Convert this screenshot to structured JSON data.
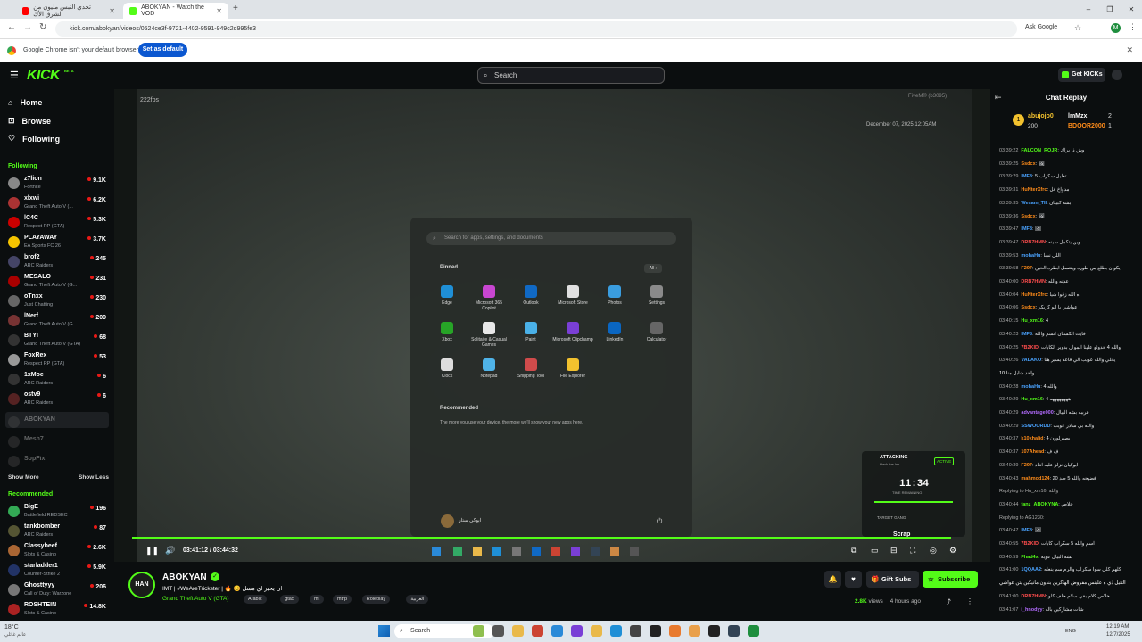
{
  "browser": {
    "tabs": [
      {
        "label": "تحدي النبس مليون من الشرق الأك",
        "favicon_color": "#ff0000"
      },
      {
        "label": "ABOKYAN - Watch the VOD",
        "favicon_color": "#53fc18"
      }
    ],
    "new_tab": "+",
    "window": {
      "minimize": "–",
      "restore": "❐",
      "close": "✕"
    },
    "url": "kick.com/abokyan/videos/0524ce3f-9721-4402-9591-949c2d995fe3",
    "ask_google": "Ask Google",
    "profile": "M",
    "infobar_message": "Google Chrome isn't your default browser",
    "infobar_button": "Set as default",
    "infobar_close": "✕"
  },
  "kick": {
    "logo": "KICK",
    "logo_badge": "BETA",
    "search_placeholder": "Search",
    "get_kicks": "Get KICKs",
    "accent": "#53fc18"
  },
  "sidebar": {
    "nav": [
      {
        "label": "Home",
        "icon": "home-icon"
      },
      {
        "label": "Browse",
        "icon": "browse-icon"
      },
      {
        "label": "Following",
        "icon": "heart-icon"
      }
    ],
    "following_header": "Following",
    "following": [
      {
        "name": "z7lion",
        "sub": "Fortnite",
        "count": "9.1K",
        "color": "#888"
      },
      {
        "name": "xlxwi",
        "sub": "Grand Theft Auto V (...",
        "count": "6.2K",
        "color": "#a33"
      },
      {
        "name": "lC4C",
        "sub": "Respect RP (GTA)",
        "count": "5.3K",
        "color": "#c00"
      },
      {
        "name": "PLAYAWAY",
        "sub": "EA Sports FC 26",
        "count": "3.7K",
        "color": "#f5c400"
      },
      {
        "name": "brof2",
        "sub": "ARC Raiders",
        "count": "245",
        "color": "#446"
      },
      {
        "name": "MESALO",
        "sub": "Grand Theft Auto V (G...",
        "count": "231",
        "color": "#a00"
      },
      {
        "name": "oTnxx",
        "sub": "Just Chatting",
        "count": "230",
        "color": "#666"
      },
      {
        "name": "lNerf",
        "sub": "Grand Theft Auto V (G...",
        "count": "209",
        "color": "#733"
      },
      {
        "name": "BTYI",
        "sub": "Grand Theft Auto V (GTA)",
        "count": "68",
        "color": "#333"
      },
      {
        "name": "FoxRex",
        "sub": "Respect RP (GTA)",
        "count": "53",
        "color": "#999"
      },
      {
        "name": "1xMoe",
        "sub": "ARC Raiders",
        "count": "6",
        "color": "#333"
      },
      {
        "name": "ostv9",
        "sub": "ARC Raiders",
        "count": "6",
        "color": "#522"
      }
    ],
    "offline": [
      {
        "name": "ABOKYAN"
      },
      {
        "name": "Mesh7"
      },
      {
        "name": "SopFix"
      }
    ],
    "show_more": "Show More",
    "show_less": "Show Less",
    "recommended_header": "Recommended",
    "recommended": [
      {
        "name": "BigE",
        "sub": "Battlefield REDSEC",
        "count": "196",
        "color": "#3a5"
      },
      {
        "name": "tankbomber",
        "sub": "ARC Raiders",
        "count": "87",
        "color": "#553"
      },
      {
        "name": "Classybeef",
        "sub": "Slots & Casino",
        "count": "2.6K",
        "color": "#a63"
      },
      {
        "name": "starladder1",
        "sub": "Counter-Strike 2",
        "count": "5.9K",
        "color": "#236"
      },
      {
        "name": "Ghosttyyy",
        "sub": "Call of Duty: Warzone",
        "count": "206",
        "color": "#777"
      },
      {
        "name": "ROSHTEIN",
        "sub": "Slots & Casino",
        "count": "14.8K",
        "color": "#a22"
      }
    ]
  },
  "video": {
    "fps": "222fps",
    "watermark": "FiveM® (b3095)",
    "date_overlay": "December 07, 2025 12:05AM",
    "start_search": "Search for apps, settings, and documents",
    "pinned": "Pinned",
    "all": "All",
    "apps": [
      "Edge",
      "Microsoft 365 Copilot",
      "Outlook",
      "Microsoft Store",
      "Photos",
      "Settings",
      "Xbox",
      "Solitaire & Casual Games",
      "Paint",
      "Microsoft Clipchamp",
      "LinkedIn",
      "Calculator",
      "Clock",
      "Notepad",
      "Snipping Tool",
      "File Explorer"
    ],
    "app_colors": [
      "#1f8fd6",
      "#c846d1",
      "#1069c4",
      "#e0e0e0",
      "#3a9ddf",
      "#8a8a8a",
      "#27a427",
      "#e8e8e8",
      "#4ab1e8",
      "#7a3fd6",
      "#0a66c2",
      "#666",
      "#ddd",
      "#4fb3e8",
      "#d04b4b",
      "#f2c12e"
    ],
    "recommended": "Recommended",
    "recommended_text": "The more you use your device, the more we'll show your new apps here.",
    "user_name": "ابوكي ستار",
    "power": "⏻",
    "hud": {
      "title": "ATTACKING",
      "sub": "Hack the lab",
      "status": "ACTIVE",
      "timer": "11:34",
      "timer_label": "TIME REMAINING",
      "target": "TARGET GANG",
      "target_name": "Scrap"
    },
    "time": "03:41:12 / 03:44:32",
    "progress": 0.985
  },
  "channel": {
    "name": "ABOKYAN",
    "avatar_text": "HAN",
    "title": "IMT | #WeAreTrickster | 🔥 😊 ان يحير اي مسل",
    "category": "Grand Theft Auto V (GTA)",
    "tags": [
      "Arabic",
      "gta5",
      "mt",
      "mtrp",
      "Roleplay",
      "العربية"
    ],
    "gift": "Gift Subs",
    "subscribe": "Subscribe",
    "views": "2.8K",
    "views_label": "views",
    "ago": "4 hours ago",
    "share": "⤴",
    "more": "⋮"
  },
  "chat": {
    "title": "Chat Replay",
    "leader": {
      "name": "abujojo0",
      "amount": "200",
      "second": "lmMzx",
      "second_n": "2",
      "third": "BDOOR2000",
      "third_n": "1"
    },
    "messages": [
      {
        "t": "03:39:22",
        "u": "FALCON_ROJR",
        "c": "#53fc18",
        "m": "وش ذا براك"
      },
      {
        "t": "03:39:25",
        "u": "Ssdcx",
        "c": "#ff8c1a",
        "m": "🖼"
      },
      {
        "t": "03:39:29",
        "u": "IMF8",
        "c": "#4aa3ff",
        "m": "5 تعليل سكراب"
      },
      {
        "t": "03:39:31",
        "u": "HuNterXfrc",
        "c": "#ff8c1a",
        "m": "مدواخ فل"
      },
      {
        "t": "03:39:35",
        "u": "Wesam_TII",
        "c": "#4aa3ff",
        "m": "بشه كبيبان"
      },
      {
        "t": "03:39:36",
        "u": "Ssdcx",
        "c": "#ff8c1a",
        "m": "🖼"
      },
      {
        "t": "03:39:47",
        "u": "IMF8",
        "c": "#4aa3ff",
        "m": "🖼"
      },
      {
        "t": "03:39:47",
        "u": "DRB7HMN",
        "c": "#ff4d4d",
        "m": "وين يتكمل سينه"
      },
      {
        "t": "03:39:53",
        "u": "mohaHu",
        "c": "#4aa3ff",
        "m": "اللى نسا"
      },
      {
        "t": "03:39:58",
        "u": "F297",
        "c": "#ff8c1a",
        "m": "يكوان بطلع من طوره وينتسل ابطره الحين"
      },
      {
        "t": "03:40:00",
        "u": "DRB7HMN",
        "c": "#ff4d4d",
        "m": "عدنه والله"
      },
      {
        "t": "03:40:04",
        "u": "HuNterXfrc",
        "c": "#ff8c1a",
        "m": "ه الله زقوا شيا"
      },
      {
        "t": "03:40:06",
        "u": "Ssdcx",
        "c": "#ff8c1a",
        "m": "عواشي يا ابو كريكر"
      },
      {
        "t": "03:40:15",
        "u": "Hu_xm16",
        "c": "#53fc18",
        "m": "4"
      },
      {
        "t": "03:40:23",
        "u": "IMF8",
        "c": "#4aa3ff",
        "m": "فايت الكسبان اتسم والله"
      },
      {
        "t": "03:40:25",
        "u": "7B2KID",
        "c": "#ff4d4d",
        "m": "والله 4 حدوثو علينا الموال بدوير الكابات"
      },
      {
        "t": "03:40:26",
        "u": "VALAKO",
        "c": "#4aa3ff",
        "m": "يحلي والله عويب الي فاعد يسير هنا"
      },
      {
        "t": "",
        "u": "",
        "c": "#fff",
        "m": "10 واحد شابل منا"
      },
      {
        "t": "03:40:28",
        "u": "mohaHu",
        "c": "#4aa3ff",
        "m": "4 والله"
      },
      {
        "t": "03:40:29",
        "u": "Hu_xm16",
        "c": "#53fc18",
        "m": "4 ههههههههه"
      },
      {
        "t": "03:40:29",
        "u": "advantage000",
        "c": "#b36bff",
        "m": "عرببه بشه البيال"
      },
      {
        "t": "03:40:29",
        "u": "SSWOORDD",
        "c": "#4aa3ff",
        "m": "والله بي سادر عوبب"
      },
      {
        "t": "03:40:37",
        "u": "k10khalid",
        "c": "#ff8c1a",
        "m": "4 يصبرلوون"
      },
      {
        "t": "03:40:37",
        "u": "107Ahead",
        "c": "#ff8c1a",
        "m": "ف ف"
      },
      {
        "t": "03:40:39",
        "u": "F297",
        "c": "#ff8c1a",
        "m": "ابوكيان نزلز عليه انتاد"
      },
      {
        "t": "03:40:43",
        "u": "mahmod124",
        "c": "#ff8c1a",
        "m": "20 فضيحه والله 5 ضد"
      },
      {
        "t": "",
        "u": "",
        "c": "#aaa",
        "m": "Replying to Hu_xm16: والله"
      },
      {
        "t": "03:40:44",
        "u": "fanz_ABOKYNA",
        "c": "#53fc18",
        "m": "خلاص"
      },
      {
        "t": "",
        "u": "",
        "c": "#aaa",
        "m": "Replying to AG1230:"
      },
      {
        "t": "03:40:47",
        "u": "IMF8",
        "c": "#4aa3ff",
        "m": "🖼"
      },
      {
        "t": "03:40:55",
        "u": "7B2KID",
        "c": "#ff4d4d",
        "m": "اسم والله 5 سكراب كابات"
      },
      {
        "t": "03:40:59",
        "u": "Fhad4x",
        "c": "#53fc18",
        "m": "بشه البيال عوبه"
      },
      {
        "t": "03:41:00",
        "u": "1QQAA2",
        "c": "#4aa3ff",
        "m": "كلهم كلي سوا سكراب والرم سم بنعله"
      },
      {
        "t": "",
        "u": "",
        "c": "#fff",
        "m": "التتيل ذي ه علينس مفروض الهاكرين بندون مانيكين يتن عواشي"
      },
      {
        "t": "03:41:00",
        "u": "DRB7HMN",
        "c": "#ff4d4d",
        "m": "خلاص كلام بقي سلام حلف كلو"
      },
      {
        "t": "03:41:07",
        "u": "i_hnodyy",
        "c": "#b36bff",
        "m": "شات مشاركين باله"
      }
    ]
  },
  "taskbar": {
    "weather_temp": "18°C",
    "weather_text": "عالم غائلي",
    "search": "Search",
    "lang": "ENG",
    "time": "12:19 AM",
    "date": "12/7/2025"
  }
}
